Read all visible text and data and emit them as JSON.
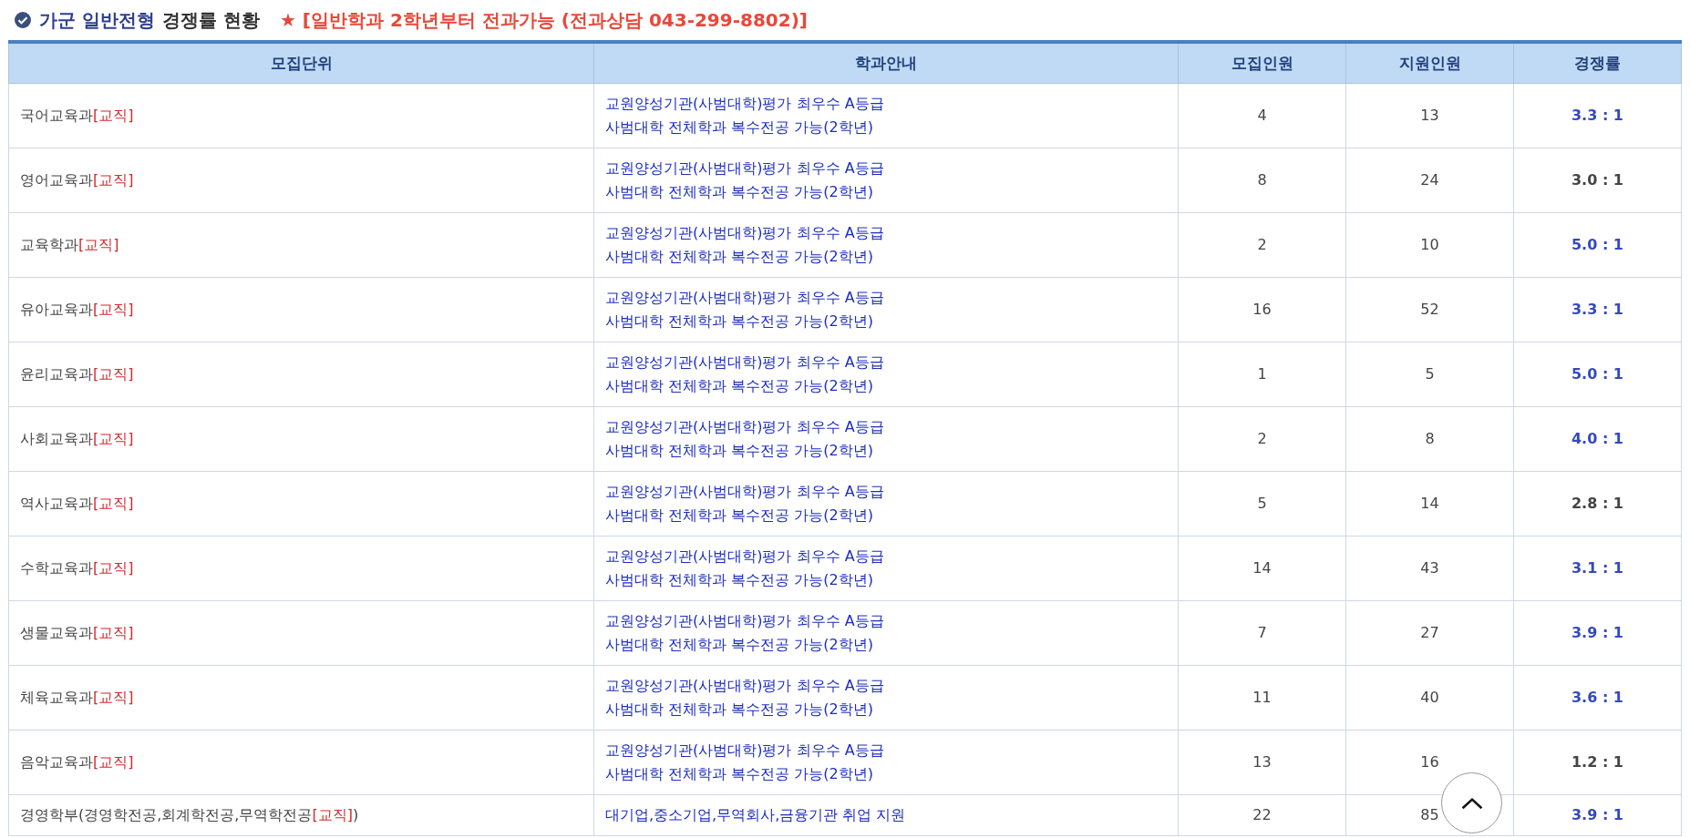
{
  "heading": {
    "group": "가군 일반전형",
    "title": "경쟁률 현황",
    "notice": "★ [일반학과 2학년부터 전과가능 (전과상담 043-299-8802)]"
  },
  "table": {
    "columns": [
      "모집단위",
      "학과안내",
      "모집인원",
      "지원인원",
      "경쟁률"
    ],
    "rows": [
      {
        "unit": "국어교육과",
        "tag": "[교직]",
        "info": [
          "교원양성기관(사범대학)평가 최우수 A등급",
          "사범대학 전체학과 복수전공 가능(2학년)"
        ],
        "quota": "4",
        "applicants": "13",
        "ratio": "3.3 : 1",
        "highlighted": true
      },
      {
        "unit": "영어교육과",
        "tag": "[교직]",
        "info": [
          "교원양성기관(사범대학)평가 최우수 A등급",
          "사범대학 전체학과 복수전공 가능(2학년)"
        ],
        "quota": "8",
        "applicants": "24",
        "ratio": "3.0 : 1",
        "highlighted": false
      },
      {
        "unit": "교육학과",
        "tag": "[교직]",
        "info": [
          "교원양성기관(사범대학)평가 최우수 A등급",
          "사범대학 전체학과 복수전공 가능(2학년)"
        ],
        "quota": "2",
        "applicants": "10",
        "ratio": "5.0 : 1",
        "highlighted": true
      },
      {
        "unit": "유아교육과",
        "tag": "[교직]",
        "info": [
          "교원양성기관(사범대학)평가 최우수 A등급",
          "사범대학 전체학과 복수전공 가능(2학년)"
        ],
        "quota": "16",
        "applicants": "52",
        "ratio": "3.3 : 1",
        "highlighted": true
      },
      {
        "unit": "윤리교육과",
        "tag": "[교직]",
        "info": [
          "교원양성기관(사범대학)평가 최우수 A등급",
          "사범대학 전체학과 복수전공 가능(2학년)"
        ],
        "quota": "1",
        "applicants": "5",
        "ratio": "5.0 : 1",
        "highlighted": true
      },
      {
        "unit": "사회교육과",
        "tag": "[교직]",
        "info": [
          "교원양성기관(사범대학)평가 최우수 A등급",
          "사범대학 전체학과 복수전공 가능(2학년)"
        ],
        "quota": "2",
        "applicants": "8",
        "ratio": "4.0 : 1",
        "highlighted": true
      },
      {
        "unit": "역사교육과",
        "tag": "[교직]",
        "info": [
          "교원양성기관(사범대학)평가 최우수 A등급",
          "사범대학 전체학과 복수전공 가능(2학년)"
        ],
        "quota": "5",
        "applicants": "14",
        "ratio": "2.8 : 1",
        "highlighted": false
      },
      {
        "unit": "수학교육과",
        "tag": "[교직]",
        "info": [
          "교원양성기관(사범대학)평가 최우수 A등급",
          "사범대학 전체학과 복수전공 가능(2학년)"
        ],
        "quota": "14",
        "applicants": "43",
        "ratio": "3.1 : 1",
        "highlighted": true
      },
      {
        "unit": "생물교육과",
        "tag": "[교직]",
        "info": [
          "교원양성기관(사범대학)평가 최우수 A등급",
          "사범대학 전체학과 복수전공 가능(2학년)"
        ],
        "quota": "7",
        "applicants": "27",
        "ratio": "3.9 : 1",
        "highlighted": true
      },
      {
        "unit": "체육교육과",
        "tag": "[교직]",
        "info": [
          "교원양성기관(사범대학)평가 최우수 A등급",
          "사범대학 전체학과 복수전공 가능(2학년)"
        ],
        "quota": "11",
        "applicants": "40",
        "ratio": "3.6 : 1",
        "highlighted": true
      },
      {
        "unit": "음악교육과",
        "tag": "[교직]",
        "info": [
          "교원양성기관(사범대학)평가 최우수 A등급",
          "사범대학 전체학과 복수전공 가능(2학년)"
        ],
        "quota": "13",
        "applicants": "16",
        "ratio": "1.2 : 1",
        "highlighted": false
      },
      {
        "unit": "경영학부(경영학전공,회계학전공,무역학전공",
        "tag": "[교직]",
        "unit_end": ")",
        "info": [
          "대기업,중소기업,무역회사,금융기관 취업 지원"
        ],
        "quota": "22",
        "applicants": "85",
        "ratio": "3.9 : 1",
        "highlighted": true
      }
    ]
  }
}
